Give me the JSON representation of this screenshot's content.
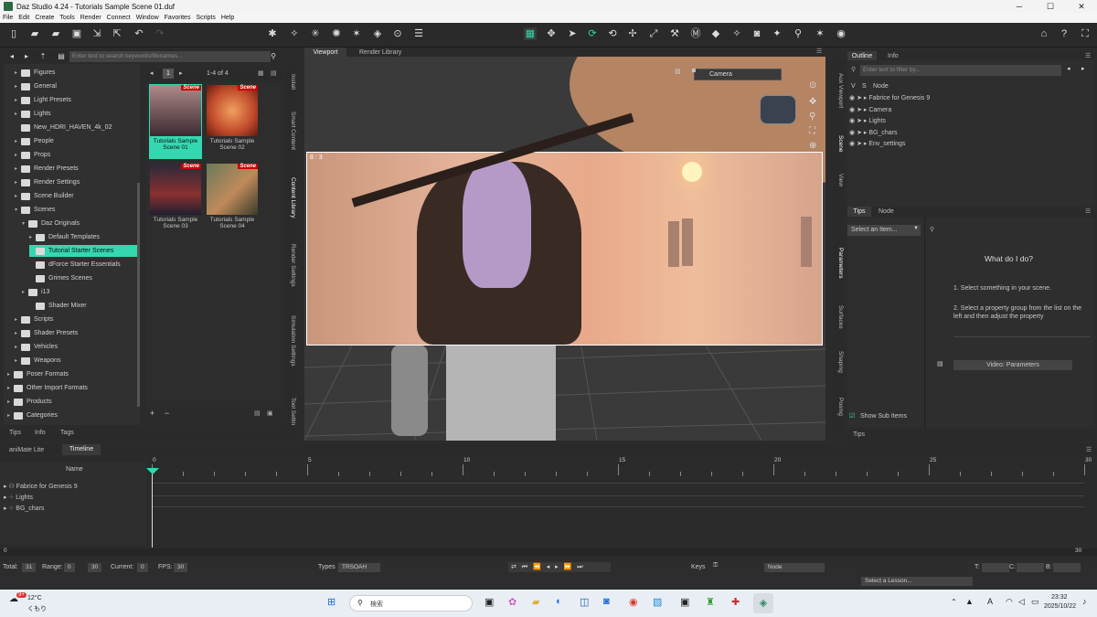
{
  "window": {
    "title": "Daz Studio 4.24 - Tutorials Sample Scene 01.duf",
    "min": "─",
    "max": "☐",
    "close": "✕"
  },
  "menu": [
    "File",
    "Edit",
    "Create",
    "Tools",
    "Render",
    "Connect",
    "Window",
    "Favorites",
    "Scripts",
    "Help"
  ],
  "library": {
    "search_placeholder": "Enter text to search keywords/filenames...",
    "page": "1",
    "count": "1-4 of 4",
    "tree": [
      {
        "label": "Figures",
        "indent": 1
      },
      {
        "label": "General",
        "indent": 1
      },
      {
        "label": "Light Presets",
        "indent": 1
      },
      {
        "label": "Lights",
        "indent": 1
      },
      {
        "label": "New_HDRI_HAVEN_4k_02",
        "indent": 1
      },
      {
        "label": "People",
        "indent": 1
      },
      {
        "label": "Props",
        "indent": 1
      },
      {
        "label": "Render Presets",
        "indent": 1
      },
      {
        "label": "Render Settings",
        "indent": 1
      },
      {
        "label": "Scene Builder",
        "indent": 1
      },
      {
        "label": "Scenes",
        "indent": 1
      },
      {
        "label": "Daz Originals",
        "indent": 2
      },
      {
        "label": "Default Templates",
        "indent": 3
      },
      {
        "label": "Tutorial Starter Scenes",
        "indent": 3
      },
      {
        "label": "dForce Starter Essentials",
        "indent": 3
      },
      {
        "label": "Grimes Scenes",
        "indent": 3
      },
      {
        "label": "i13",
        "indent": 2
      },
      {
        "label": "Shader Mixer",
        "indent": 3
      },
      {
        "label": "Scripts",
        "indent": 1
      },
      {
        "label": "Shader Presets",
        "indent": 1
      },
      {
        "label": "Vehicles",
        "indent": 1
      },
      {
        "label": "Weapons",
        "indent": 1
      },
      {
        "label": "Poser Formats",
        "indent": 0
      },
      {
        "label": "Other Import Formats",
        "indent": 0
      },
      {
        "label": "Products",
        "indent": 0
      },
      {
        "label": "Categories",
        "indent": 0
      }
    ],
    "selected_tree": "Tutorial Starter Scenes",
    "thumbs": [
      {
        "label": "Tutorials Sample Scene 01",
        "badge": "Scene"
      },
      {
        "label": "Tutorials Sample Scene 02",
        "badge": "Scene"
      },
      {
        "label": "Tutorials Sample Scene 03",
        "badge": "Scene"
      },
      {
        "label": "Tutorials Sample Scene 04",
        "badge": "Scene"
      }
    ],
    "bottom_tabs": [
      "Tips",
      "Info",
      "Tags"
    ],
    "add": "+",
    "remove": "−"
  },
  "side_tabs_left": [
    "Install",
    "Smart Content",
    "Content Library",
    "Render Settings",
    "Simulation Settings",
    "Tool Settin"
  ],
  "viewport": {
    "tabs": [
      "Viewport",
      "Render Library"
    ],
    "camera": "Camera",
    "aspect": "8 : 3"
  },
  "outline": {
    "tabs": [
      "Outline",
      "Info"
    ],
    "filter_placeholder": "Enter text to filter by...",
    "cols": [
      "V",
      "S",
      "Node"
    ],
    "nodes": [
      "Fabrice for Genesis 9",
      "Camera",
      "Lights",
      "BG_chars",
      "Env_settings"
    ]
  },
  "right_side_tabs": [
    "Aux Viewport",
    "Scene",
    "View",
    "Parameters",
    "Surfaces",
    "Shaping",
    "Posing"
  ],
  "tips": {
    "tabs": [
      "Tips",
      "Node"
    ],
    "select": "Select an Item...",
    "heading": "What do I do?",
    "step1": "1. Select something in your scene.",
    "step2": "2. Select a property group from the list on the left and then adjust the property",
    "video": "Video: Parameters",
    "show_sub": "Show Sub Items",
    "bottom_tab": "Tips"
  },
  "timeline": {
    "tabs": [
      "aniMate Lite",
      "Timeline"
    ],
    "name_col": "Name",
    "ticks": [
      "0",
      "5",
      "10",
      "15",
      "20",
      "25",
      "30"
    ],
    "tracks": [
      "Fabrice for Genesis 9",
      "Lights",
      "BG_chars"
    ],
    "start": "0",
    "end": "30"
  },
  "status": {
    "total_label": "Total:",
    "total": "31",
    "range_label": "Range:",
    "range_start": "0",
    "range_end": "30",
    "current_label": "Current:",
    "current": "0",
    "fps_label": "FPS:",
    "fps": "30",
    "types_label": "Types",
    "types": "TRSOAH",
    "keys_label": "Keys",
    "node": "Node",
    "t_label": "T:",
    "c_label": "C:",
    "b_label": "B:",
    "lesson": "Select a Lesson..."
  },
  "taskbar": {
    "temp": "12°C",
    "weather": "くもり",
    "search": "検索",
    "time": "23:32",
    "date": "2025/10/22",
    "lang": "A",
    "badge": "9+"
  },
  "colors": {
    "accent": "#34d8b0",
    "badge": "#cc0000"
  }
}
